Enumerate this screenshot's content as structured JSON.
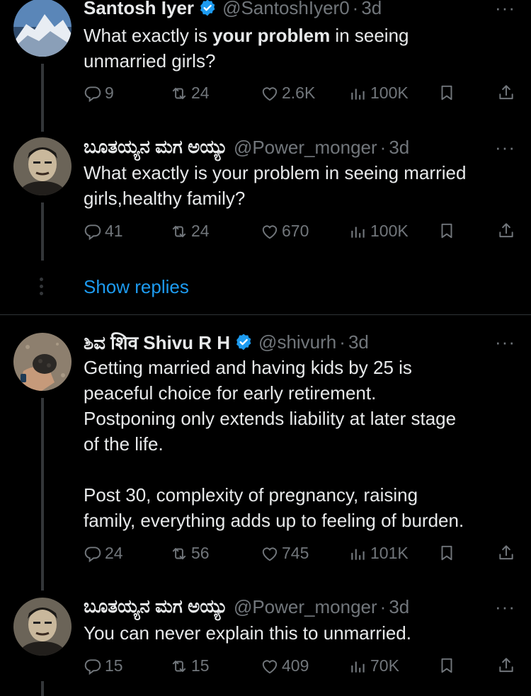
{
  "tweets": [
    {
      "name": "Santosh Iyer",
      "verified": true,
      "handle": "@SantoshIyer0",
      "dot": "·",
      "time": "3d",
      "more": "···",
      "text_pre": "What exactly is ",
      "text_bold": "your problem",
      "text_post": " in seeing\nunmarried girls?",
      "replies": "9",
      "reposts": "24",
      "likes": "2.6K",
      "views": "100K",
      "avatar": "mountain-avatar"
    },
    {
      "name": "ಬೂತಯ್ಯನ ಮಗ ಅಯ್ಯು",
      "verified": false,
      "handle": "@Power_monger",
      "dot": "·",
      "time": "3d",
      "more": "···",
      "text": "What exactly is your problem in seeing married\ngirls,healthy family?",
      "replies": "41",
      "reposts": "24",
      "likes": "670",
      "views": "100K",
      "avatar": "man-portrait-avatar"
    },
    {
      "name": "ಶಿವ शिव Shivu R H",
      "verified": true,
      "handle": "@shivurh",
      "dot": "·",
      "time": "3d",
      "more": "···",
      "text": "Getting married and having kids by 25 is\npeaceful choice for early retirement.\nPostponing only extends liability at later stage\nof the life.\n\nPost 30, complexity of pregnancy, raising\nfamily, everything adds up to feeling of burden.",
      "replies": "24",
      "reposts": "56",
      "likes": "745",
      "views": "101K",
      "avatar": "hand-stone-avatar"
    },
    {
      "name": "ಬೂತಯ್ಯನ ಮಗ ಅಯ್ಯು",
      "verified": false,
      "handle": "@Power_monger",
      "dot": "·",
      "time": "3d",
      "more": "···",
      "text": "You can never explain this to unmarried.",
      "replies": "15",
      "reposts": "15",
      "likes": "409",
      "views": "70K",
      "avatar": "man-portrait-avatar"
    }
  ],
  "show_replies": "Show replies",
  "colors": {
    "accent": "#1d9bf0",
    "muted": "#71767b",
    "text": "#e7e9ea",
    "background": "#000000"
  }
}
